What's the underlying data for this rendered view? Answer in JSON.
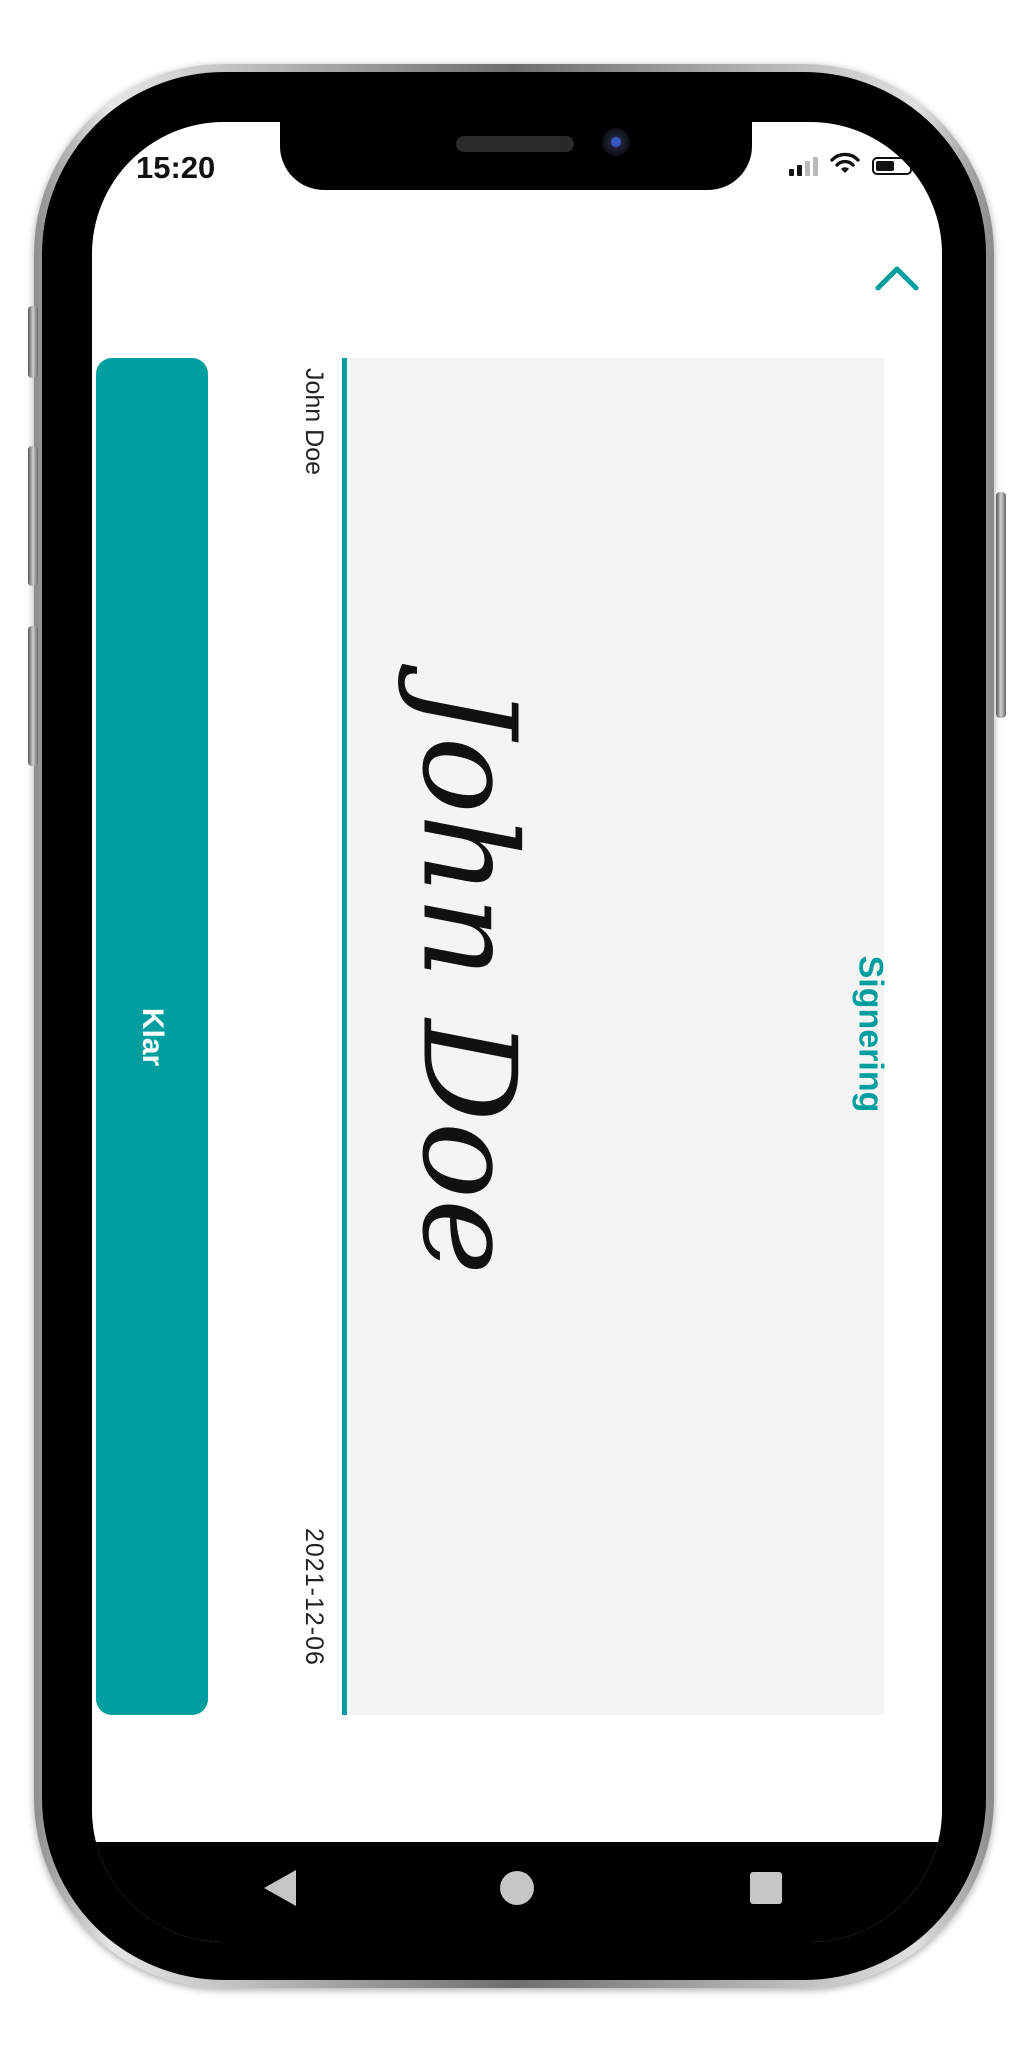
{
  "status_bar": {
    "time": "15:20",
    "signal_icon": "cellular-signal-icon",
    "wifi_icon": "wifi-icon",
    "battery_icon": "battery-icon",
    "battery_level": 0.55
  },
  "header": {
    "collapse_icon": "chevron-up-icon",
    "title": "Signering"
  },
  "signature": {
    "signer_name": "John Doe",
    "date": "2021-12-06",
    "signature_text": "John Doe"
  },
  "actions": {
    "done_label": "Klar"
  },
  "nav_bar": {
    "back_icon": "back-triangle-icon",
    "home_icon": "home-circle-icon",
    "recents_icon": "recents-square-icon"
  },
  "colors": {
    "accent": "#009e9e",
    "signature_panel": "#f4f4f4",
    "nav_bar": "#000000"
  }
}
